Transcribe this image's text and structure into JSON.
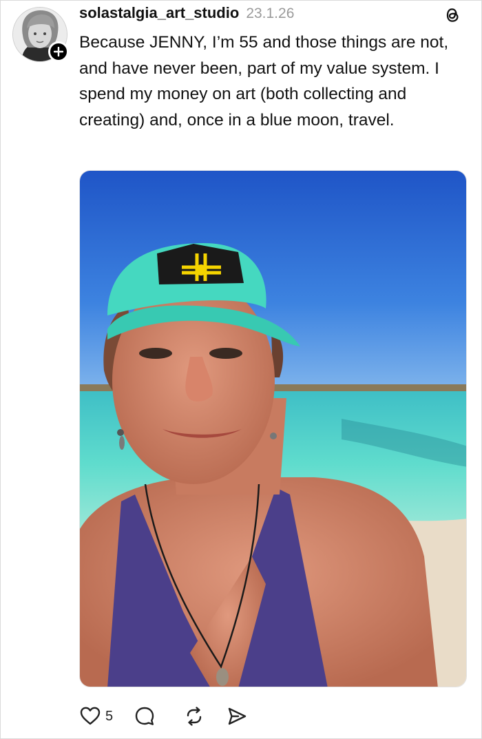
{
  "post": {
    "username": "solastalgia_art_studio",
    "timestamp": "23.1.26",
    "text": "Because JENNY, I’m 55 and those things are not, and have never been, part of my value system. I spend my money on art (both collecting and creating) and, once in a blue moon, travel.",
    "photo_icon": "beach-selfie-photo"
  },
  "actions": {
    "like_count": "5",
    "icons": [
      "heart-icon",
      "comment-icon",
      "repost-icon",
      "share-icon"
    ]
  },
  "colors": {
    "text": "#111111",
    "muted": "#9a9a9a",
    "sky": "#2f6fd6",
    "sea": "#4fd3c4",
    "cap": "#3fd9c0"
  }
}
